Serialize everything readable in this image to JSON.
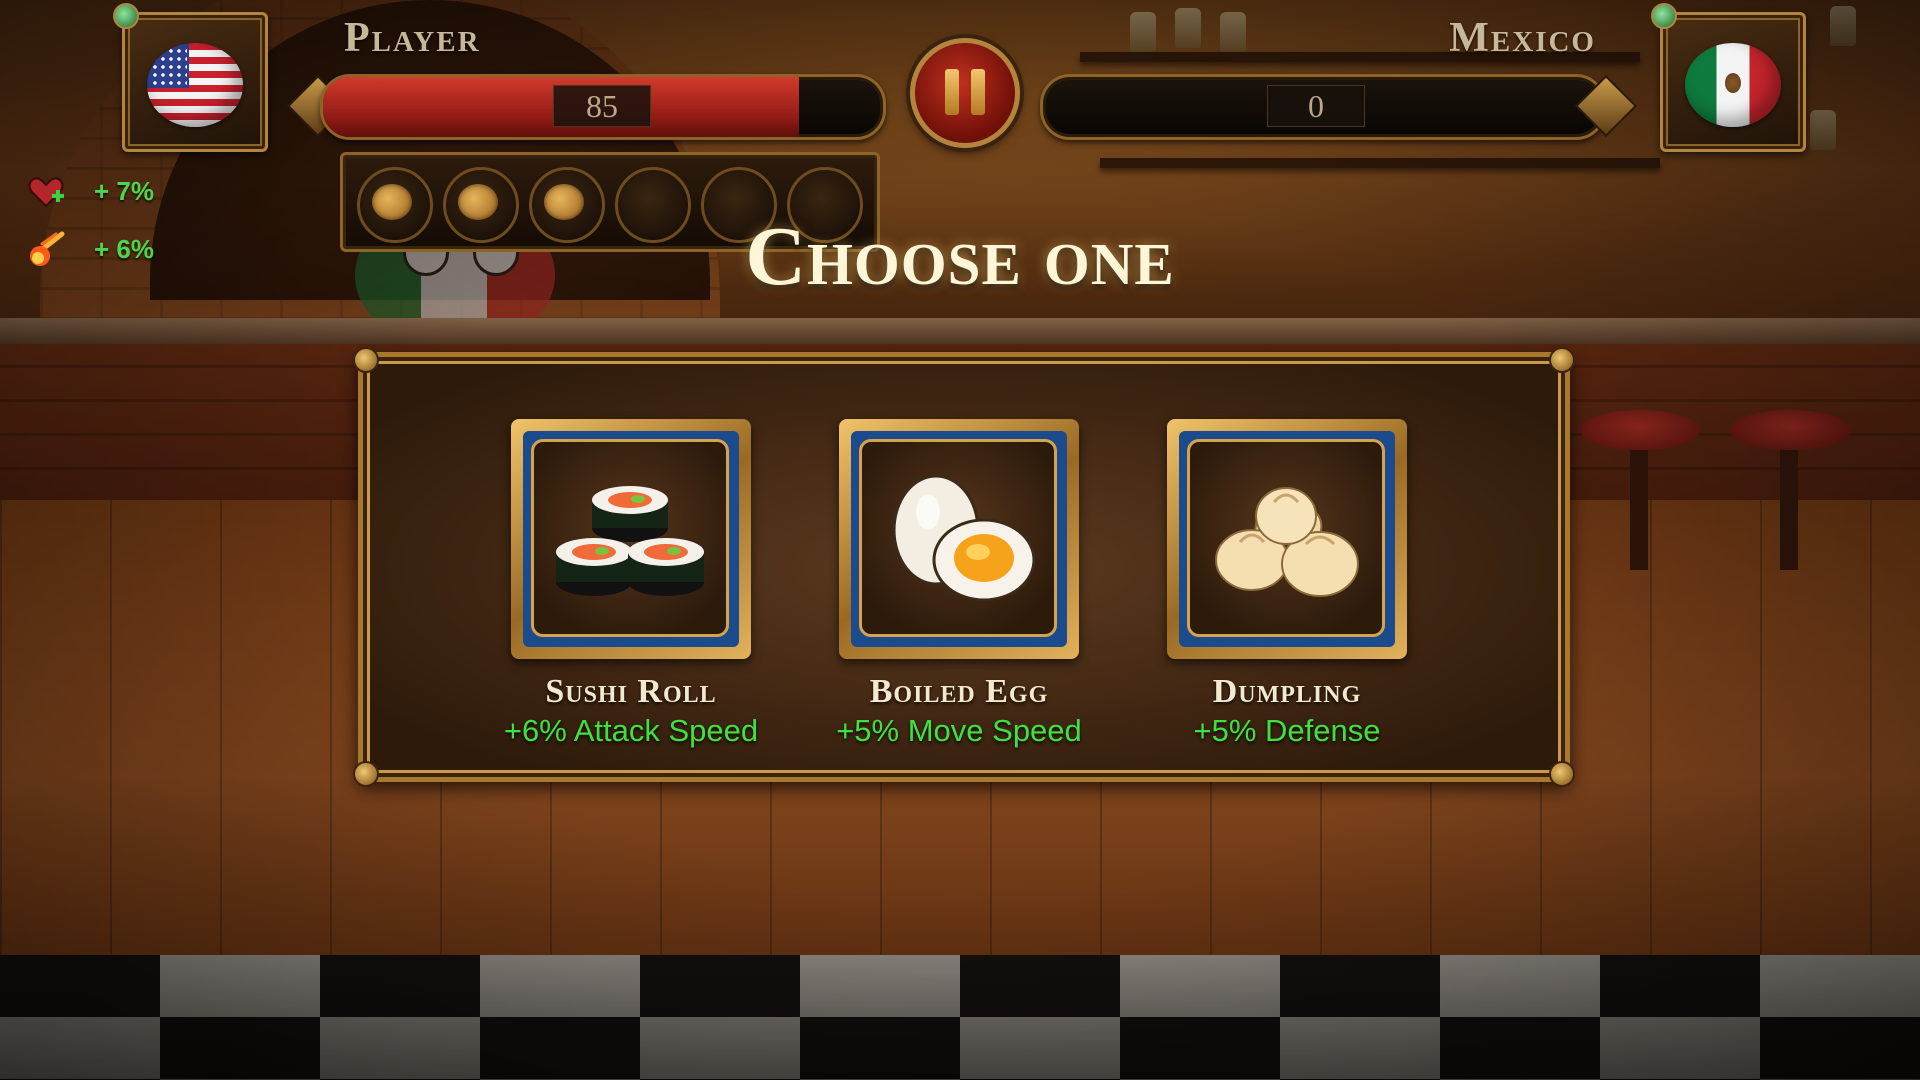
{
  "hud": {
    "player": {
      "name": "Player",
      "flag_icon": "usa-flag-ball-icon",
      "hp": "85",
      "hp_fraction": 0.85
    },
    "opponent": {
      "name": "Mexico",
      "flag_icon": "mexico-flag-ball-icon",
      "hp": "0",
      "hp_fraction": 0
    },
    "pause_icon": "pause-icon",
    "food_slots": [
      {
        "filled": true,
        "icon": "food-icon"
      },
      {
        "filled": true,
        "icon": "food-icon"
      },
      {
        "filled": true,
        "icon": "food-icon"
      },
      {
        "filled": false,
        "icon": ""
      },
      {
        "filled": false,
        "icon": ""
      },
      {
        "filled": false,
        "icon": ""
      }
    ],
    "buffs": [
      {
        "icon": "heart-plus-icon",
        "text": "+ 7%"
      },
      {
        "icon": "fire-meteor-icon",
        "text": "+ 6%"
      }
    ]
  },
  "modal": {
    "title": "Choose one",
    "choices": [
      {
        "name": "Sushi Roll",
        "effect": "+6% Attack Speed",
        "icon": "sushi-roll-icon"
      },
      {
        "name": "Boiled Egg",
        "effect": "+5% Move Speed",
        "icon": "boiled-egg-icon"
      },
      {
        "name": "Dumpling",
        "effect": "+5% Defense",
        "icon": "dumpling-icon"
      }
    ]
  },
  "colors": {
    "gold_frame": "#b2843d",
    "hp_red": "#c0301f",
    "effect_green": "#3fe03f",
    "card_blue": "#1b4b8c"
  }
}
